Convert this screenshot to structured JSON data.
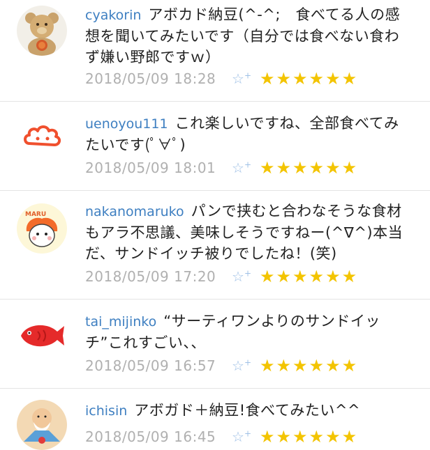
{
  "comments": [
    {
      "user": "cyakorin",
      "text": "アボカド納豆(^-^;　食べてる人の感想を聞いてみたいです（自分では食べない食わず嫌い野郎ですｗ）",
      "date": "2018/05/09 18:28",
      "add_star": "☆",
      "add_plus": "+",
      "stars": "★★★★★★",
      "avatar_icon": "teddy-bear-icon"
    },
    {
      "user": "uenoyou111",
      "text": "これ楽しいですね、全部食べてみたいです(ﾟ∀ﾟ)",
      "date": "2018/05/09 18:01",
      "add_star": "☆",
      "add_plus": "+",
      "stars": "★★★★★★",
      "avatar_icon": "cloud-face-icon"
    },
    {
      "user": "nakanomaruko",
      "text": "パンで挟むと合わなそうな食材もアラ不思議、美味しそうですねー(^∇^)本当だ、サンドイッチ被りでしたね！(笑)",
      "date": "2018/05/09 17:20",
      "add_star": "☆",
      "add_plus": "+",
      "stars": "★★★★★★",
      "avatar_icon": "maru-character-icon",
      "avatar_label": "MARU"
    },
    {
      "user": "tai_mijinko",
      "text": "“サーティワンよりのサンドイッチ”これすごい、、",
      "date": "2018/05/09 16:57",
      "add_star": "☆",
      "add_plus": "+",
      "stars": "★★★★★★",
      "avatar_icon": "red-fish-icon"
    },
    {
      "user": "ichisin",
      "text": "アボガド＋納豆!食べてみたい^^",
      "date": "2018/05/09 16:45",
      "add_star": "☆",
      "add_plus": "+",
      "stars": "★★★★★★",
      "avatar_icon": "old-man-icon"
    }
  ],
  "colors": {
    "username": "#3e7fc1",
    "date": "#b0b0b0",
    "star": "#f3c400",
    "add_star": "#9fc0e6",
    "divider": "#e4e4e4"
  }
}
